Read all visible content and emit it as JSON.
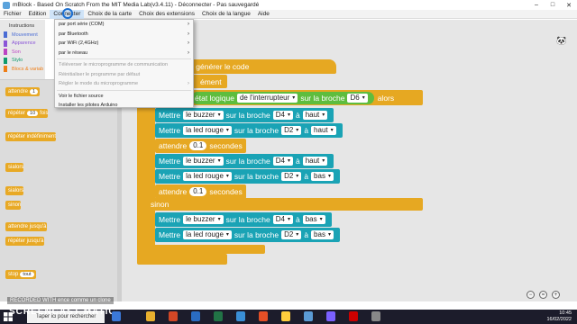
{
  "window": {
    "title": "mBlock - Based On Scratch From the MIT Media Lab(v3.4.11) - Déconnecter - Pas sauvegardé",
    "controls": [
      "–",
      "□",
      "✕"
    ]
  },
  "menu": [
    "Fichier",
    "Edition",
    "Connecter",
    "Choix de la carte",
    "Choix des extensions",
    "Choix de la langue",
    "Aide"
  ],
  "dropdown": {
    "items": [
      {
        "label": "par port série (COM)",
        "submenu": true,
        "disabled": false
      },
      {
        "label": "par Bluetooth",
        "submenu": true,
        "disabled": false
      },
      {
        "label": "par WiFi (2,4GHz)",
        "submenu": true,
        "disabled": false
      },
      {
        "label": "par le réseau",
        "submenu": true,
        "disabled": false
      },
      {
        "label": "Téléverser le microprogramme de communication",
        "submenu": false,
        "disabled": true
      },
      {
        "label": "Réinitialiser le programme par défaut",
        "submenu": false,
        "disabled": true
      },
      {
        "label": "Régler le mode du microprogramme",
        "submenu": true,
        "disabled": true
      },
      {
        "label": "Voir le fichier source",
        "submenu": false,
        "disabled": false
      },
      {
        "label": "Installer les pilotes Arduino",
        "submenu": false,
        "disabled": false
      }
    ]
  },
  "palette": {
    "header": "Instructions",
    "categories": [
      {
        "label": "Mouvement",
        "color": "#4a6cd4"
      },
      {
        "label": "Apparence",
        "color": "#8a55d7"
      },
      {
        "label": "Son",
        "color": "#bb42c3"
      },
      {
        "label": "Stylo",
        "color": "#0e9a6c"
      },
      {
        "label": "Blocs & variab",
        "color": "#ee7d16"
      }
    ]
  },
  "palette_blocks": [
    {
      "text": "attendre",
      "arg": "1"
    },
    {
      "text": "répéter",
      "arg": "10",
      "suffix": "fois"
    },
    {
      "text": "répéter indéfiniment"
    },
    {
      "text": "si",
      "suffix": "alors"
    },
    {
      "text": "si",
      "suffix": "alors"
    },
    {
      "text": "sinon"
    },
    {
      "text": "attendre jusqu'à"
    },
    {
      "text": "répéter jusqu'à"
    },
    {
      "text": "stop",
      "arg": "tout"
    }
  ],
  "script": {
    "hat": "e - générer le code",
    "loop": "ément",
    "if_label": "si",
    "if_state": "état logique",
    "if_reporter": "de l'interrupteur",
    "if_pin_label": "sur la broche",
    "if_pin": "D6",
    "if_then": "alors",
    "else_label": "sinon",
    "rows": [
      {
        "kind": "set",
        "verb": "Mettre",
        "dev": "le buzzer",
        "mid": "sur la broche",
        "pin": "D4",
        "a": "à",
        "val": "haut"
      },
      {
        "kind": "set",
        "verb": "Mettre",
        "dev": "la led rouge",
        "mid": "sur la broche",
        "pin": "D2",
        "a": "à",
        "val": "haut"
      },
      {
        "kind": "wait",
        "verb": "attendre",
        "num": "0.1",
        "unit": "secondes"
      },
      {
        "kind": "set",
        "verb": "Mettre",
        "dev": "le buzzer",
        "mid": "sur la broche",
        "pin": "D4",
        "a": "à",
        "val": "haut"
      },
      {
        "kind": "set",
        "verb": "Mettre",
        "dev": "la led rouge",
        "mid": "sur la broche",
        "pin": "D2",
        "a": "à",
        "val": "bas"
      },
      {
        "kind": "wait",
        "verb": "attendre",
        "num": "0.1",
        "unit": "secondes"
      },
      {
        "kind": "set",
        "verb": "Mettre",
        "dev": "le buzzer",
        "mid": "sur la broche",
        "pin": "D4",
        "a": "à",
        "val": "bas"
      },
      {
        "kind": "set",
        "verb": "Mettre",
        "dev": "la led rouge",
        "mid": "sur la broche",
        "pin": "D2",
        "a": "à",
        "val": "bas"
      }
    ]
  },
  "overlay": {
    "recorded": "RECORDED WITH",
    "watermark": "SCREENCAST",
    "watermark2": "MATIC",
    "hidden_text": "ence comme un clone"
  },
  "taskbar": {
    "search_placeholder": "Taper ici pour rechercher",
    "time": "10:45",
    "date": "16/02/2022"
  }
}
